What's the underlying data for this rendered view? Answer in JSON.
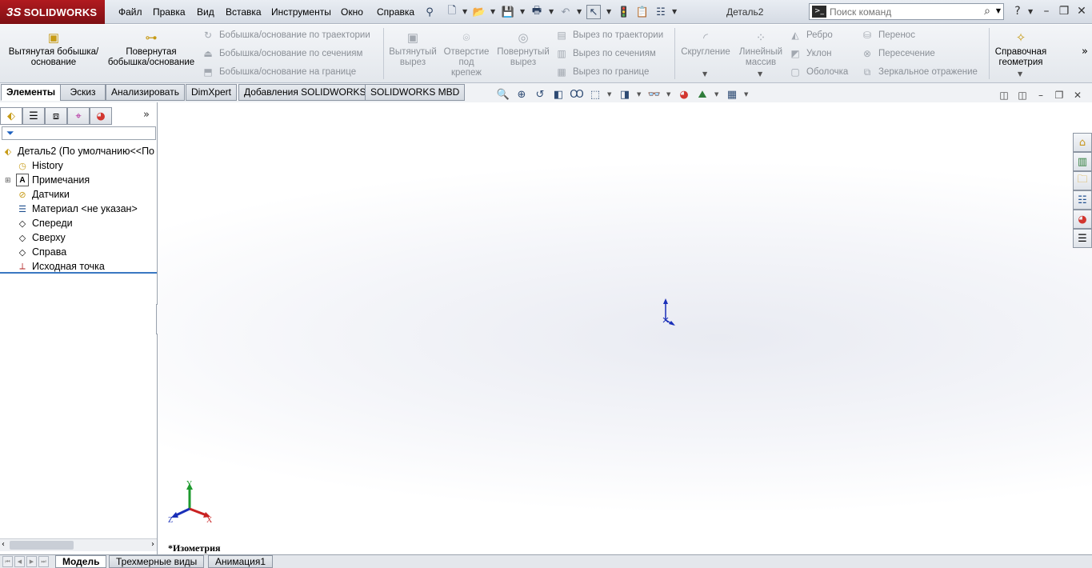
{
  "app": {
    "logo_text": "SOLIDWORKS",
    "logo_mark": "3S",
    "document_title": "Деталь2",
    "accent_color": "#a6161b"
  },
  "menu": [
    "Файл",
    "Правка",
    "Вид",
    "Вставка",
    "Инструменты",
    "Окно",
    "Справка"
  ],
  "search": {
    "placeholder": "Поиск команд"
  },
  "ribbon": {
    "extruded_boss": "Вытянутая бобышка/основание",
    "revolved_boss": "Повернутая бобышка/основание",
    "swept_boss": "Бобышка/основание по траектории",
    "lofted_boss": "Бобышка/основание по сечениям",
    "boundary_boss": "Бобышка/основание на границе",
    "extruded_cut": "Вытянутый вырез",
    "hole_wizard": "Отверстие под крепеж",
    "revolved_cut": "Повернутый вырез",
    "swept_cut": "Вырез по траектории",
    "lofted_cut": "Вырез по сечениям",
    "boundary_cut": "Вырез по границе",
    "fillet": "Скругление",
    "linear_pattern": "Линейный массив",
    "rib": "Ребро",
    "draft": "Уклон",
    "shell": "Оболочка",
    "wrap": "Перенос",
    "intersect": "Пересечение",
    "mirror": "Зеркальное отражение",
    "reference_geometry": "Справочная геометрия"
  },
  "tabs": [
    "Элементы",
    "Эскиз",
    "Анализировать",
    "DimXpert",
    "Добавления SOLIDWORKS",
    "SOLIDWORKS MBD"
  ],
  "feature_tree": {
    "root": "Деталь2  (По умолчанию<<По",
    "items": [
      "History",
      "Примечания",
      "Датчики",
      "Материал <не указан>",
      "Спереди",
      "Сверху",
      "Справа",
      "Исходная точка"
    ]
  },
  "viewport": {
    "view_name": "*Изометрия",
    "triad": {
      "x": "X",
      "y": "Y",
      "z": "Z"
    }
  },
  "bottom_tabs": [
    "Модель",
    "Трехмерные виды",
    "Анимация1"
  ]
}
